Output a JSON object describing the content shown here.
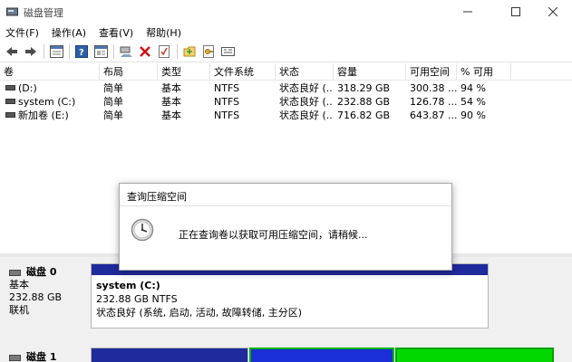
{
  "window": {
    "title": "磁盘管理"
  },
  "menu": [
    {
      "label": "文件(F)"
    },
    {
      "label": "操作(A)"
    },
    {
      "label": "查看(V)"
    },
    {
      "label": "帮助(H)"
    }
  ],
  "toolbar": {
    "icons": [
      "back-arrow-icon",
      "forward-arrow-icon",
      "properties-icon",
      "help-icon",
      "console-icon",
      "connect-icon",
      "delete-icon",
      "check-icon",
      "folder-icon",
      "key-icon",
      "settings-icon"
    ]
  },
  "volume_list": {
    "columns": [
      "卷",
      "布局",
      "类型",
      "文件系统",
      "状态",
      "容量",
      "可用空间",
      "% 可用"
    ],
    "rows": [
      [
        "(D:)",
        "简单",
        "基本",
        "NTFS",
        "状态良好 (...",
        "318.29 GB",
        "300.38 ...",
        "94 %"
      ],
      [
        "system (C:)",
        "简单",
        "基本",
        "NTFS",
        "状态良好 (...",
        "232.88 GB",
        "126.78 ...",
        "54 %"
      ],
      [
        "新加卷 (E:)",
        "简单",
        "基本",
        "NTFS",
        "状态良好 (...",
        "716.82 GB",
        "643.87 ...",
        "90 %"
      ]
    ]
  },
  "disks": [
    {
      "name": "磁盘 0",
      "type": "基本",
      "size": "232.88 GB",
      "status": "联机",
      "partition": {
        "name": "system  (C:)",
        "size_fs": "232.88 GB NTFS",
        "status": "状态良好 (系统, 启动, 活动, 故障转储, 主分区)"
      }
    },
    {
      "name": "磁盘 1"
    }
  ],
  "dialog": {
    "title": "查询压缩空间",
    "message": "正在查询卷以获取可用压缩空间，请稍候..."
  },
  "colors": {
    "primary_partition": "#1f2a9c",
    "logical_partition": "#00a000",
    "extended": "#00c000"
  }
}
